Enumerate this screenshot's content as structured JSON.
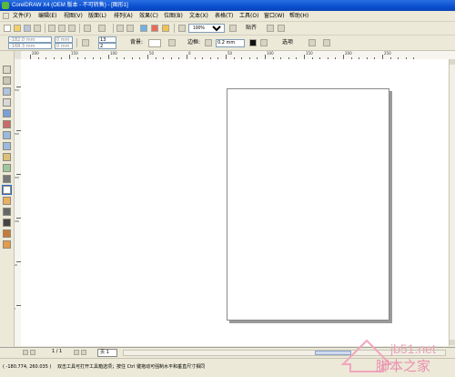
{
  "window": {
    "title": "CorelDRAW X4 (OEM 版本 - 不可转售) - [图形1]"
  },
  "menu": [
    "文件(F)",
    "编辑(E)",
    "视图(V)",
    "版面(L)",
    "排列(A)",
    "效果(C)",
    "位图(B)",
    "文本(X)",
    "表格(T)",
    "工具(O)",
    "窗口(W)",
    "帮助(H)"
  ],
  "toolbar": {
    "zoom_value": "100%",
    "snap_label": "贴齐",
    "zoom_options": [
      "100%"
    ]
  },
  "property_bar": {
    "x_value": "-182.0 mm",
    "y_value": "-168.3 mm",
    "w_value": "0 mm",
    "h_value": "0 mm",
    "size_label": "13",
    "cols_value": "2",
    "background_label": "背景:",
    "border_label": "边框:",
    "outline_value": "0.2 mm",
    "options_label": "选项"
  },
  "ruler": {
    "h_labels": [
      "200",
      "150",
      "100",
      "50",
      "0",
      "50",
      "100",
      "150",
      "200",
      "250"
    ],
    "v_labels": [
      "250",
      "200",
      "150",
      "100",
      "50",
      "0"
    ]
  },
  "tools": [
    "pick-tool-icon",
    "shape-tool-icon",
    "crop-tool-icon",
    "zoom-tool-icon",
    "freehand-tool-icon",
    "smart-fill-icon",
    "rectangle-tool-icon",
    "ellipse-tool-icon",
    "polygon-tool-icon",
    "basic-shapes-icon",
    "text-tool-icon",
    "table-tool-icon",
    "interactive-blend-icon",
    "eyedropper-icon",
    "outline-tool-icon",
    "fill-tool-icon",
    "interactive-fill-icon"
  ],
  "page_nav": {
    "page_count": "1 / 1",
    "page_tab": "页 1"
  },
  "status": {
    "coords": "( -180.774, 260.035 )",
    "hint": "双击工具可打开工具箱选项；按住 Ctrl 键拖动可强制水平和垂直尺寸相同"
  },
  "watermark": {
    "site": "jb51.net",
    "brand": "脚本之家"
  },
  "colors": {
    "title_bar": "#0a4fcf",
    "chrome": "#ece9d8",
    "page_shadow": "#9a9a9a"
  }
}
